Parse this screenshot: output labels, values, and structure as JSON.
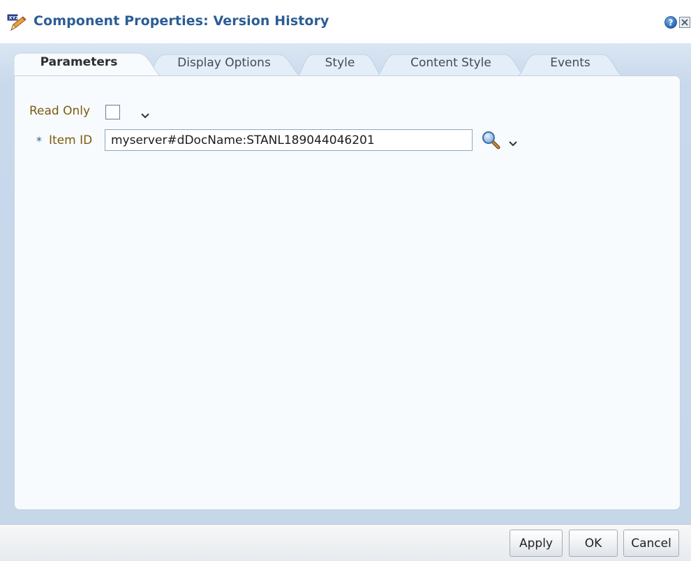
{
  "title": {
    "text": "Component Properties: Version History",
    "icon": "component-properties-icon"
  },
  "header_icons": [
    "help-icon",
    "close-icon"
  ],
  "tabs": [
    {
      "label": "Parameters",
      "active": true
    },
    {
      "label": "Display Options",
      "active": false
    },
    {
      "label": "Style",
      "active": false
    },
    {
      "label": "Content Style",
      "active": false
    },
    {
      "label": "Events",
      "active": false
    }
  ],
  "form": {
    "read_only": {
      "label": "Read Only",
      "checked": false
    },
    "item_id": {
      "required_marker": "*",
      "label": "Item ID",
      "value": "myserver#dDocName:STANL189044046201"
    }
  },
  "buttons": {
    "apply": "Apply",
    "ok": "OK",
    "cancel": "Cancel"
  },
  "colors": {
    "title": "#2b5d96",
    "label": "#7b5b10",
    "body_background": "#c8d9ec",
    "panel_background": "#f8fbfd"
  }
}
